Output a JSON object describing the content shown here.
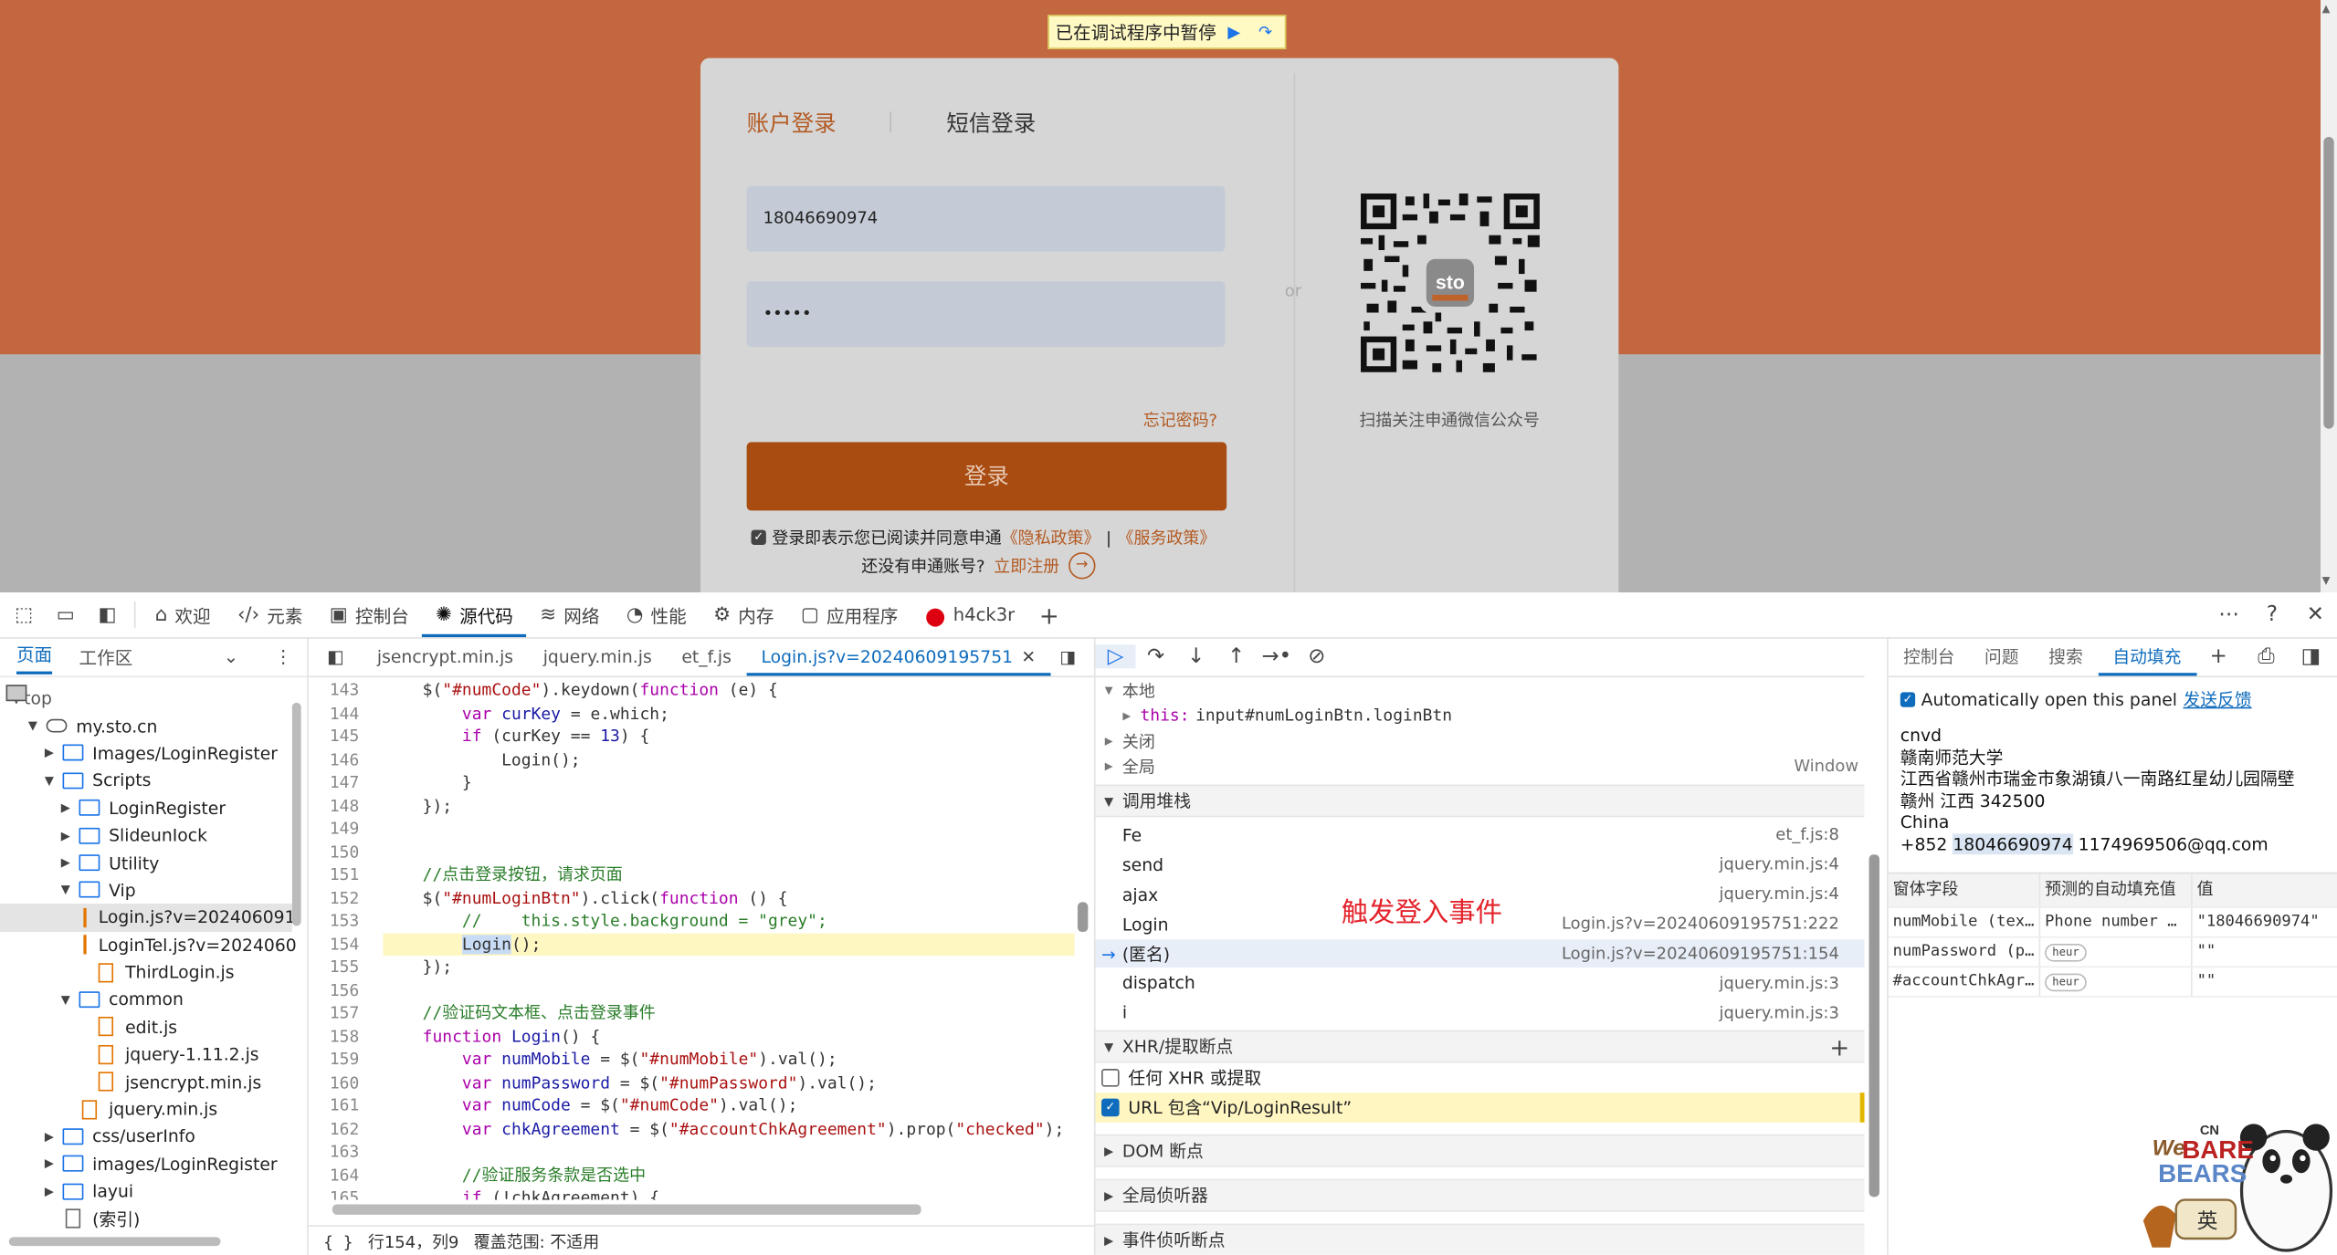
{
  "paused_bar": {
    "text": "已在调试程序中暂停",
    "resume_icon": "resume-icon",
    "step_icon": "step-over-icon"
  },
  "login": {
    "tab_account": "账户登录",
    "tab_sms": "短信登录",
    "phone_value": "18046690974",
    "password_value": "•••••",
    "forgot": "忘记密码?",
    "submit": "登录",
    "agree_prefix": "登录即表示您已阅读并同意申通",
    "privacy": "《隐私政策》",
    "sep": "|",
    "service": "《服务政策》",
    "no_account": "还没有申通账号?",
    "register": "立即注册",
    "or": "or",
    "qr_caption": "扫描关注申通微信公众号",
    "qr_badge": "sto",
    "banner_color": "#e0612a",
    "accent_color": "#a84c12"
  },
  "devtools": {
    "tabs": [
      {
        "label": "欢迎",
        "icon": "home-icon"
      },
      {
        "label": "元素",
        "icon": "code-icon"
      },
      {
        "label": "控制台",
        "icon": "console-icon"
      },
      {
        "label": "源代码",
        "icon": "bug-icon"
      },
      {
        "label": "网络",
        "icon": "wifi-icon"
      },
      {
        "label": "性能",
        "icon": "gauge-icon"
      },
      {
        "label": "内存",
        "icon": "gear-icon"
      },
      {
        "label": "应用程序",
        "icon": "app-icon"
      },
      {
        "label": "h4ck3r",
        "icon": "among-us-icon"
      }
    ],
    "nav": {
      "tab_page": "页面",
      "tab_workspace": "工作区",
      "tree": [
        {
          "label": "top",
          "depth": 0,
          "kind": "page",
          "open": true
        },
        {
          "label": "my.sto.cn",
          "depth": 1,
          "kind": "cloud",
          "open": true
        },
        {
          "label": "Images/LoginRegister",
          "depth": 2,
          "kind": "folder",
          "open": false
        },
        {
          "label": "Scripts",
          "depth": 2,
          "kind": "folder",
          "open": true
        },
        {
          "label": "LoginRegister",
          "depth": 3,
          "kind": "folder",
          "open": false
        },
        {
          "label": "SlideunIock",
          "depth": 3,
          "kind": "folder",
          "open": false
        },
        {
          "label": "Utility",
          "depth": 3,
          "kind": "folder",
          "open": false
        },
        {
          "label": "Vip",
          "depth": 3,
          "kind": "folder",
          "open": true
        },
        {
          "label": "Login.js?v=202406091",
          "depth": 4,
          "kind": "file",
          "selected": true
        },
        {
          "label": "LoginTel.js?v=2024060",
          "depth": 4,
          "kind": "file"
        },
        {
          "label": "ThirdLogin.js",
          "depth": 4,
          "kind": "file"
        },
        {
          "label": "common",
          "depth": 3,
          "kind": "folder",
          "open": true
        },
        {
          "label": "edit.js",
          "depth": 4,
          "kind": "file"
        },
        {
          "label": "jquery-1.11.2.js",
          "depth": 4,
          "kind": "file"
        },
        {
          "label": "jsencrypt.min.js",
          "depth": 4,
          "kind": "file"
        },
        {
          "label": "jquery.min.js",
          "depth": 3,
          "kind": "file"
        },
        {
          "label": "css/userInfo",
          "depth": 2,
          "kind": "folder",
          "open": false
        },
        {
          "label": "images/LoginRegister",
          "depth": 2,
          "kind": "folder",
          "open": false
        },
        {
          "label": "layui",
          "depth": 2,
          "kind": "folder",
          "open": false
        },
        {
          "label": "(索引)",
          "depth": 2,
          "kind": "file-plain"
        }
      ]
    },
    "editor": {
      "tabs": [
        "jsencrypt.min.js",
        "jquery.min.js",
        "et_f.js",
        "Login.js?v=20240609195751"
      ],
      "active_tab": 3,
      "status_line": "行154，列9",
      "status_coverage": "覆盖范围: 不适用",
      "lines": [
        {
          "n": "143",
          "html": "    $(<span class='tk-str'>\"#numCode\"</span>).keydown(<span class='tk-kw'>function</span> (e) {"
        },
        {
          "n": "144",
          "html": "        <span class='tk-kw'>var</span> <span class='tk-var'>curKey</span> = e.which;"
        },
        {
          "n": "145",
          "html": "        <span class='tk-kw'>if</span> (curKey == <span class='tk-var'>13</span>) {"
        },
        {
          "n": "146",
          "html": "            Login();"
        },
        {
          "n": "147",
          "html": "        }"
        },
        {
          "n": "148",
          "html": "    });"
        },
        {
          "n": "149",
          "html": ""
        },
        {
          "n": "150",
          "html": ""
        },
        {
          "n": "151",
          "html": "    <span class='tk-cm'>//点击登录按钮，请求页面</span>"
        },
        {
          "n": "152",
          "html": "    $(<span class='tk-str'>\"#numLoginBtn\"</span>).click(<span class='tk-kw'>function</span> () {"
        },
        {
          "n": "153",
          "html": "        <span class='tk-cm'>//    this.style.background = \"grey\";</span>"
        },
        {
          "n": "154",
          "html": "        <span class='tk-sel'>Login</span>();",
          "hl": true
        },
        {
          "n": "155",
          "html": "    });"
        },
        {
          "n": "156",
          "html": ""
        },
        {
          "n": "157",
          "html": "    <span class='tk-cm'>//验证码文本框、点击登录事件</span>"
        },
        {
          "n": "158",
          "html": "    <span class='tk-kw'>function</span> <span class='tk-var'>Login</span>() {"
        },
        {
          "n": "159",
          "html": "        <span class='tk-kw'>var</span> <span class='tk-var'>numMobile</span> = $(<span class='tk-str'>\"#numMobile\"</span>).val();"
        },
        {
          "n": "160",
          "html": "        <span class='tk-kw'>var</span> <span class='tk-var'>numPassword</span> = $(<span class='tk-str'>\"#numPassword\"</span>).val();"
        },
        {
          "n": "161",
          "html": "        <span class='tk-kw'>var</span> <span class='tk-var'>numCode</span> = $(<span class='tk-str'>\"#numCode\"</span>).val();"
        },
        {
          "n": "162",
          "html": "        <span class='tk-kw'>var</span> <span class='tk-var'>chkAgreement</span> = $(<span class='tk-str'>\"#accountChkAgreement\"</span>).prop(<span class='tk-str'>\"checked\"</span>);"
        },
        {
          "n": "163",
          "html": ""
        },
        {
          "n": "164",
          "html": "        <span class='tk-cm'>//验证服务条款是否选中</span>"
        },
        {
          "n": "165",
          "html": "        <span class='tk-kw'>if</span> (!chkAgreement) {"
        }
      ]
    },
    "debugger": {
      "scope_title": "本地",
      "scope_this_key": "this:",
      "scope_this_val": "input#numLoginBtn.loginBtn",
      "scope_closure": "关闭",
      "scope_global": "全局",
      "scope_global_val": "Window",
      "callstack_title": "调用堆栈",
      "callstack": [
        {
          "fn": "Fe",
          "loc": "et_f.js:8"
        },
        {
          "fn": "send",
          "loc": "jquery.min.js:4"
        },
        {
          "fn": "ajax",
          "loc": "jquery.min.js:4"
        },
        {
          "fn": "Login",
          "loc": "Login.js?v=20240609195751:222"
        },
        {
          "fn": "(匿名)",
          "loc": "Login.js?v=20240609195751:154",
          "current": true
        },
        {
          "fn": "dispatch",
          "loc": "jquery.min.js:3"
        },
        {
          "fn": "i",
          "loc": "jquery.min.js:3"
        }
      ],
      "annotation": "触发登入事件",
      "xhr_title": "XHR/提取断点",
      "xhr_any": "任何 XHR 或提取",
      "xhr_url": "URL 包含“Vip/LoginResult”",
      "dom_title": "DOM 断点",
      "global_listeners": "全局侦听器",
      "event_listeners": "事件侦听断点"
    },
    "sidebar": {
      "tabs": [
        "控制台",
        "问题",
        "搜索",
        "自动填充"
      ],
      "active_tab": 3,
      "auto_open": "Automatically open this panel",
      "feedback": "发送反馈",
      "address": [
        "cnvd",
        "赣南师范大学",
        "江西省赣州市瑞金市象湖镇八一南路红星幼儿园隔壁",
        "赣州 江西 342500",
        "China"
      ],
      "phone_prefix": "+852 ",
      "phone": "18046690974",
      "email": " 1174969506@qq.com",
      "table_head": [
        "窗体字段",
        "预测的自动填充值",
        "值"
      ],
      "rows": [
        {
          "field": "numMobile (tex…",
          "predicted": "Phone number …",
          "value": "\"18046690974\""
        },
        {
          "field": "numPassword (p…",
          "predicted": "heur",
          "value": "\"\"",
          "chip": true
        },
        {
          "field": "#accountChkAgr…",
          "predicted": "heur",
          "value": "\"\"",
          "chip": true
        }
      ]
    }
  },
  "watermark": {
    "text1": "We",
    "text2": "BARE",
    "text3": "BEARS",
    "cn": "CN",
    "ime": "英"
  }
}
